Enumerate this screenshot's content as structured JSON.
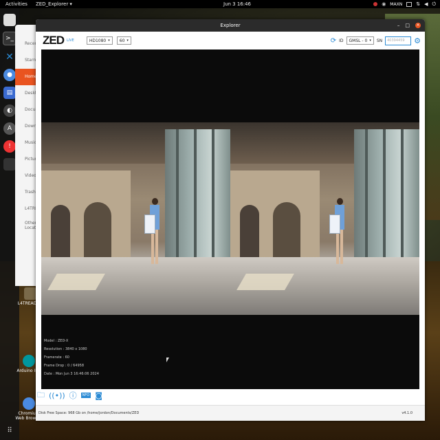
{
  "topbar": {
    "activities": "Activities",
    "app": "ZED_Explorer ▾",
    "clock": "Jun 3 16:46",
    "tray_label": "MAXN"
  },
  "file_manager": {
    "items": [
      "Recent",
      "Starred",
      "Home",
      "Desktop",
      "Documents",
      "Downloads",
      "Music",
      "Pictures",
      "Videos",
      "Trash",
      "L4TREADME",
      "Other Locations"
    ],
    "active": "Home"
  },
  "desktop_icons": [
    {
      "label": "L4TREADME",
      "icon": "folder-icon"
    },
    {
      "label": "Arduino IDE",
      "icon": "arduino-icon"
    },
    {
      "label": "Chromium Web Browser",
      "icon": "chromium-icon"
    }
  ],
  "window": {
    "title": "Explorer"
  },
  "toolbar": {
    "logo": "ZED",
    "live_label": "LIVE",
    "resolution": "HD1080",
    "fps": "60",
    "id_label": "ID",
    "camera_id": "GMSL - 0",
    "sn_label": "SN",
    "sn_placeholder": "40394459"
  },
  "info": {
    "model": "Model : ZED-X",
    "resolution": "Resolution : 3840 x 1080",
    "framerate": "Framerate : 60",
    "frame_drop": "Frame Drop : 0 / 64958",
    "date": "Date : Mon Jun 3 16:46:06 2024"
  },
  "status": {
    "disk": "Disk Free Space: 968 Gb on /home/jordon/Documents/ZED",
    "version": "v4.1.0"
  },
  "colors": {
    "accent": "#2a8ad4",
    "ubuntu_orange": "#e95420",
    "titlebar": "#2b2b2b"
  }
}
